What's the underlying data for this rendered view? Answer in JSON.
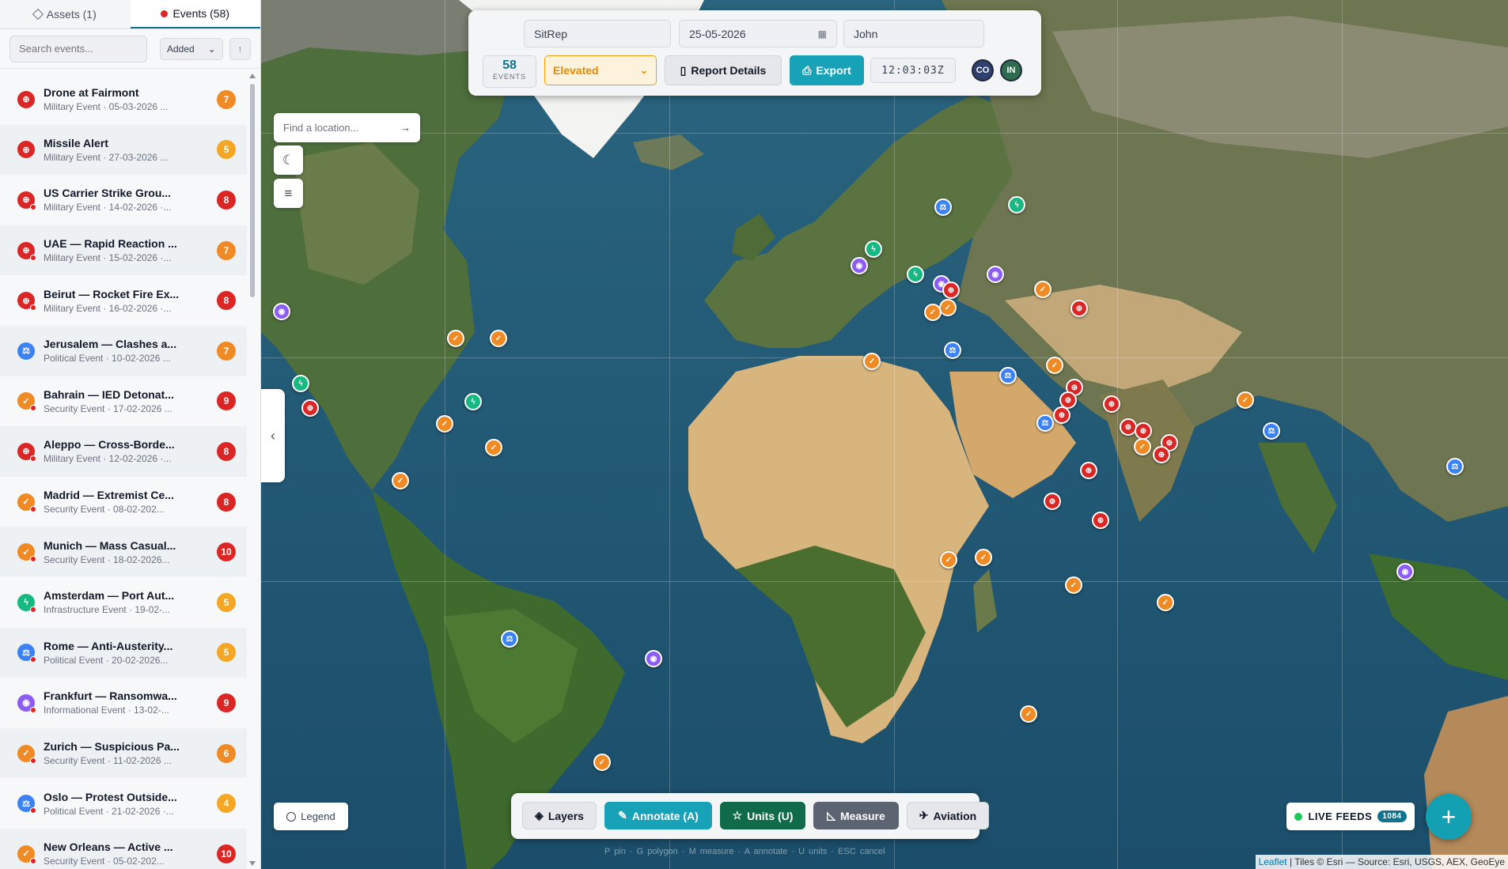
{
  "sidebar": {
    "tabs": [
      {
        "label": "Assets (1)",
        "active": false
      },
      {
        "label": "Events (58)",
        "active": true
      }
    ],
    "search_placeholder": "Search events...",
    "sort": {
      "selected": "Added"
    },
    "events": [
      {
        "title": "Drone at Fairmont",
        "subtitle": "Military Event · 05-03-2026 ...",
        "severity": "7",
        "type": "military"
      },
      {
        "title": "Missile Alert",
        "subtitle": "Military Event · 27-03-2026 ...",
        "severity": "5",
        "type": "military"
      },
      {
        "title": "US Carrier Strike Grou...",
        "subtitle": "Military Event · 14-02-2026 ·...",
        "severity": "8",
        "type": "military"
      },
      {
        "title": "UAE — Rapid Reaction ...",
        "subtitle": "Military Event · 15-02-2026 ·...",
        "severity": "7",
        "type": "military"
      },
      {
        "title": "Beirut — Rocket Fire Ex...",
        "subtitle": "Military Event · 16-02-2026 ·...",
        "severity": "8",
        "type": "military"
      },
      {
        "title": "Jerusalem — Clashes a...",
        "subtitle": "Political Event · 10-02-2026 ...",
        "severity": "7",
        "type": "political"
      },
      {
        "title": "Bahrain — IED Detonat...",
        "subtitle": "Security Event · 17-02-2026 ...",
        "severity": "9",
        "type": "security"
      },
      {
        "title": "Aleppo — Cross-Borde...",
        "subtitle": "Military Event · 12-02-2026 ·...",
        "severity": "8",
        "type": "military"
      },
      {
        "title": "Madrid — Extremist Ce...",
        "subtitle": "Security Event · 08-02-202...",
        "severity": "8",
        "type": "security"
      },
      {
        "title": "Munich — Mass Casual...",
        "subtitle": "Security Event · 18-02-2026...",
        "severity": "10",
        "type": "security"
      },
      {
        "title": "Amsterdam — Port Aut...",
        "subtitle": "Infrastructure Event · 19-02-...",
        "severity": "5",
        "type": "infrastructure"
      },
      {
        "title": "Rome — Anti-Austerity...",
        "subtitle": "Political Event · 20-02-2026...",
        "severity": "5",
        "type": "political"
      },
      {
        "title": "Frankfurt — Ransomwa...",
        "subtitle": "Informational Event · 13-02-...",
        "severity": "9",
        "type": "informational"
      },
      {
        "title": "Zurich — Suspicious Pa...",
        "subtitle": "Security Event · 11-02-2026 ...",
        "severity": "6",
        "type": "security"
      },
      {
        "title": "Oslo — Protest Outside...",
        "subtitle": "Political Event · 21-02-2026 ·...",
        "severity": "4",
        "type": "political"
      },
      {
        "title": "New Orleans — Active ...",
        "subtitle": "Security Event · 05-02-202...",
        "severity": "10",
        "type": "security"
      }
    ]
  },
  "topbar": {
    "report_name": "SitRep",
    "date": "25-05-2026",
    "author": "John",
    "events_count": "58",
    "events_label": "EVENTS",
    "threat_level": "Elevated",
    "report_details_label": "Report Details",
    "export_label": "Export",
    "clock": "12:03:03Z",
    "avatars": [
      "CO",
      "IN"
    ]
  },
  "map": {
    "location_placeholder": "Find a location...",
    "legend_label": "Legend",
    "toolbar": {
      "layers": "Layers",
      "annotate": "Annotate (A)",
      "units": "Units (U)",
      "measure": "Measure",
      "aviation": "Aviation"
    },
    "shortcut_hints": "P pin · G polygon · M measure · A annotate · U units · ESC cancel",
    "live_feeds_label": "LIVE FEEDS",
    "live_feeds_count": "1084",
    "attribution_leaflet": "Leaflet",
    "attribution_rest": "| Tiles © Esri — Source: Esri, USGS, AEX, GeoEye"
  },
  "colors": {
    "military": "#dc2626",
    "security": "#f08a24",
    "political": "#3b82f6",
    "infrastructure": "#16b981",
    "informational": "#8b5cf6",
    "accent": "#0e7490"
  }
}
